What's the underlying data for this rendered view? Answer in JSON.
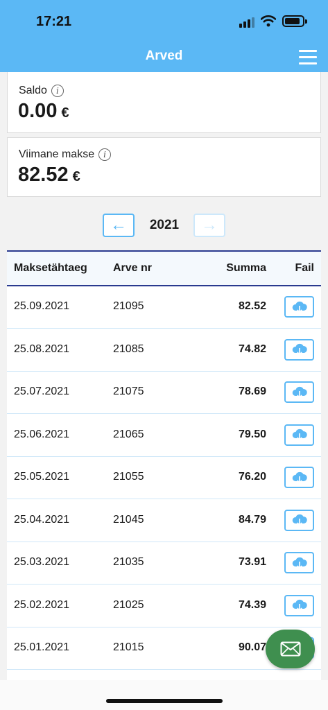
{
  "status_bar": {
    "time": "17:21"
  },
  "header": {
    "title": "Arved"
  },
  "saldo": {
    "label": "Saldo",
    "value": "0.00",
    "currency": "€"
  },
  "last_payment": {
    "label": "Viimane makse",
    "value": "82.52",
    "currency": "€"
  },
  "year_nav": {
    "prev": "←",
    "year": "2021",
    "next": "→"
  },
  "table": {
    "headers": {
      "due_date": "Maksetähtaeg",
      "invoice_nr": "Arve nr",
      "sum": "Summa",
      "file": "Fail"
    },
    "rows": [
      {
        "date": "25.09.2021",
        "nr": "21095",
        "sum": "82.52"
      },
      {
        "date": "25.08.2021",
        "nr": "21085",
        "sum": "74.82"
      },
      {
        "date": "25.07.2021",
        "nr": "21075",
        "sum": "78.69"
      },
      {
        "date": "25.06.2021",
        "nr": "21065",
        "sum": "79.50"
      },
      {
        "date": "25.05.2021",
        "nr": "21055",
        "sum": "76.20"
      },
      {
        "date": "25.04.2021",
        "nr": "21045",
        "sum": "84.79"
      },
      {
        "date": "25.03.2021",
        "nr": "21035",
        "sum": "73.91"
      },
      {
        "date": "25.02.2021",
        "nr": "21025",
        "sum": "74.39"
      },
      {
        "date": "25.01.2021",
        "nr": "21015",
        "sum": "90.07"
      }
    ]
  },
  "colors": {
    "accent": "#5bb8f5",
    "header_line": "#2a3a8f",
    "fab": "#3f8f4f"
  },
  "icons": {
    "download": "cloud-download-icon",
    "mail": "mail-icon",
    "menu": "hamburger-menu-icon",
    "info": "info-icon"
  }
}
